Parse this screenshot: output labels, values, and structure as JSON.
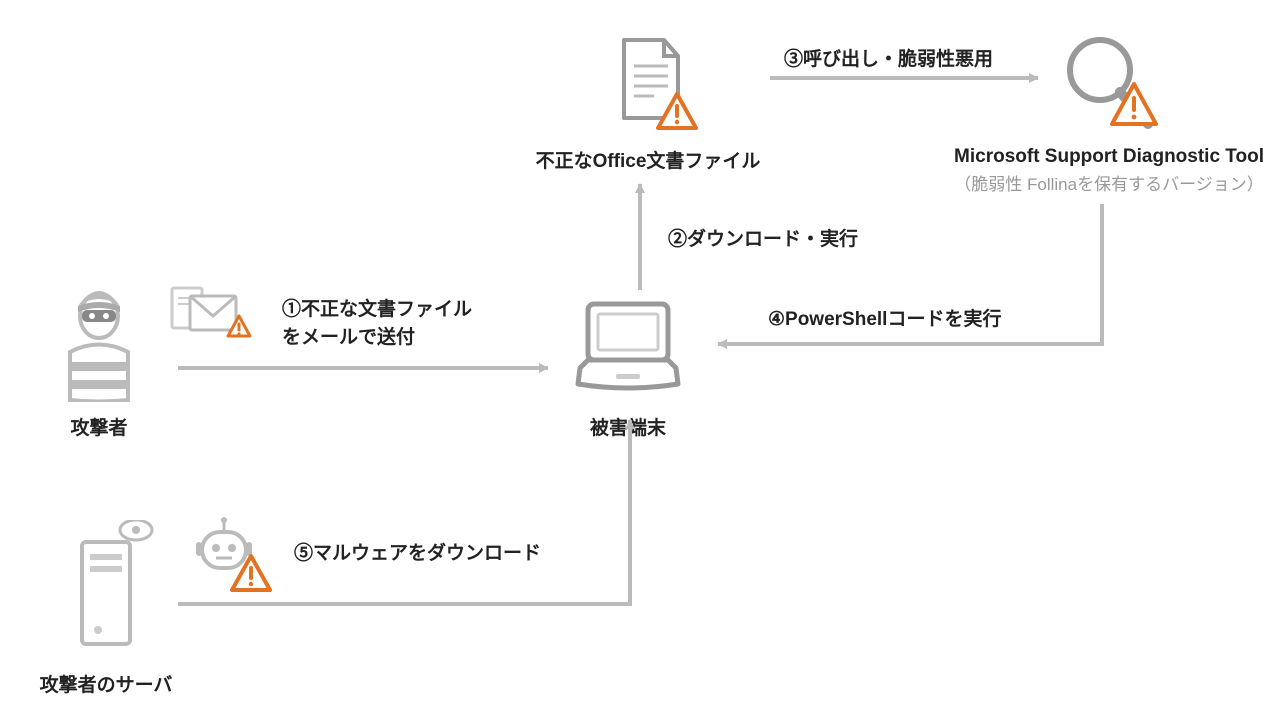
{
  "nodes": {
    "attacker": "攻撃者",
    "attacker_server": "攻撃者のサーバ",
    "victim": "被害端末",
    "office_file": "不正なOffice文書ファイル",
    "msdt": "Microsoft Support Diagnostic Tool",
    "msdt_sub": "（脆弱性 Follinaを保有するバージョン）"
  },
  "steps": {
    "s1a": "①不正な文書ファイル",
    "s1b": "をメールで送付",
    "s2": "②ダウンロード・実行",
    "s3": "③呼び出し・脆弱性悪用",
    "s4": "④PowerShellコードを実行",
    "s5": "⑤マルウェアをダウンロード"
  },
  "colors": {
    "gray": "#999999",
    "gray_light": "#bbbbbb",
    "orange": "#e37222",
    "text": "#222222"
  }
}
